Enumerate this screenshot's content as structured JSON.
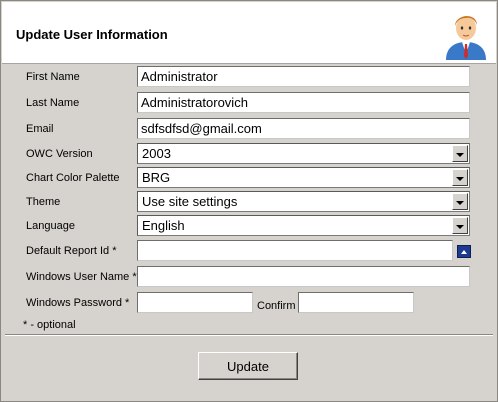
{
  "header": {
    "title": "Update User Information",
    "icon": "user-avatar-icon"
  },
  "form": {
    "first_name": {
      "label": "First Name",
      "value": "Administrator"
    },
    "last_name": {
      "label": "Last Name",
      "value": "Administratorovich"
    },
    "email": {
      "label": "Email",
      "value": "sdfsdfsd@gmail.com"
    },
    "owc_version": {
      "label": "OWC Version",
      "value": "2003"
    },
    "chart_palette": {
      "label": "Chart Color Palette",
      "value": "BRG"
    },
    "theme": {
      "label": "Theme",
      "value": "Use site settings"
    },
    "language": {
      "label": "Language",
      "value": "English"
    },
    "default_report": {
      "label": "Default Report Id *",
      "value": ""
    },
    "windows_user": {
      "label": "Windows User Name *",
      "value": ""
    },
    "windows_password": {
      "label": "Windows Password *",
      "value": ""
    },
    "confirm": {
      "label": "Confirm",
      "value": ""
    },
    "optional_note": "* - optional"
  },
  "actions": {
    "update_label": "Update"
  },
  "colors": {
    "dialog_bg": "#d6d3ce",
    "header_bg": "#ffffff",
    "lookup_button": "#1c3b8f"
  }
}
